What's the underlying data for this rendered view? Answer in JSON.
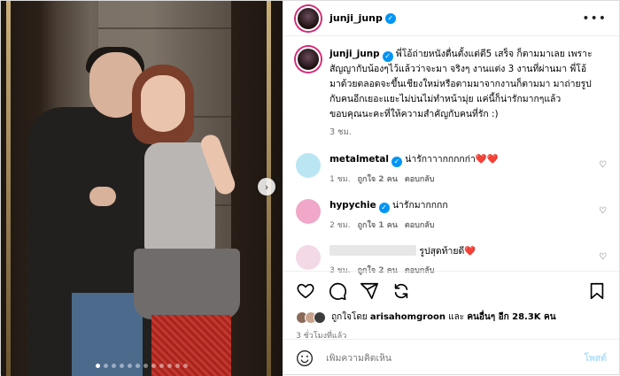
{
  "post": {
    "author": "junji_junp",
    "caption": "พี่โอ้ถ่ายหนังตื่นตั้งแต่ตี5 เสร็จ ก็ตามมาเลย เพราะสัญญากับน้องๆไว้แล้วว่าจะมา จริงๆ งานแต่ง 3 งานที่ผ่านมา พี่โอ้มาด้วยตลอดจะขึ้นเชียงใหม่หรือตามมาจากงานก็ตามมา มาถ่ายรูปกับคนอีกเยอะแยะไม่บ่นไม่ทำหน้ามุ่ย แค่นี้ก็น่ารักมากๆแล้ว ขอบคุณนะคะที่ให้ความสำคัญกับคนที่รัก :)",
    "caption_time": "3 ชม.",
    "likes_prefix": "ถูกใจโดย",
    "likes_user": "arisahomgroon",
    "likes_middle": "และ",
    "likes_others": "คนอื่นๆ อีก 28.3K คน",
    "posted_ago": "3 ชั่วโมงที่แล้ว"
  },
  "comments": [
    {
      "user": "metalmetal",
      "text": "น่ารักาาากกกกก่า",
      "emoji": "❤️❤️",
      "time": "1 ชม.",
      "likes": "ถูกใจ 2 คน",
      "reply": "ตอบกลับ",
      "avatar_color": "#b9e6f2",
      "verified": true
    },
    {
      "user": "hypychie",
      "text": "น่ารักมากกกก",
      "emoji": "",
      "time": "2 ชม.",
      "likes": "ถูกใจ 1 คน",
      "reply": "ตอบกลับ",
      "avatar_color": "#f0a7c8",
      "verified": true
    },
    {
      "user": "",
      "text": "รูปสุดท้ายดี",
      "emoji": "❤️",
      "time": "3 ชม.",
      "likes": "ถูกใจ 2 คน",
      "reply": "ตอบกลับ",
      "avatar_color": "#f3d9e6",
      "verified": false
    }
  ],
  "input": {
    "placeholder": "เพิ่มความคิดเห็น",
    "post_label": "โพสต์"
  },
  "icons": [
    "heart-icon",
    "comment-icon",
    "share-icon",
    "repost-icon",
    "bookmark-icon",
    "emoji-icon",
    "more-icon",
    "verified-icon",
    "next-arrow-icon"
  ],
  "colors": {
    "verified": "#0095f6",
    "story_ring": "#d62976",
    "post_button": "#b2dffc",
    "heart": "#e0245e"
  },
  "carousel": {
    "total": 12,
    "active": 1
  }
}
